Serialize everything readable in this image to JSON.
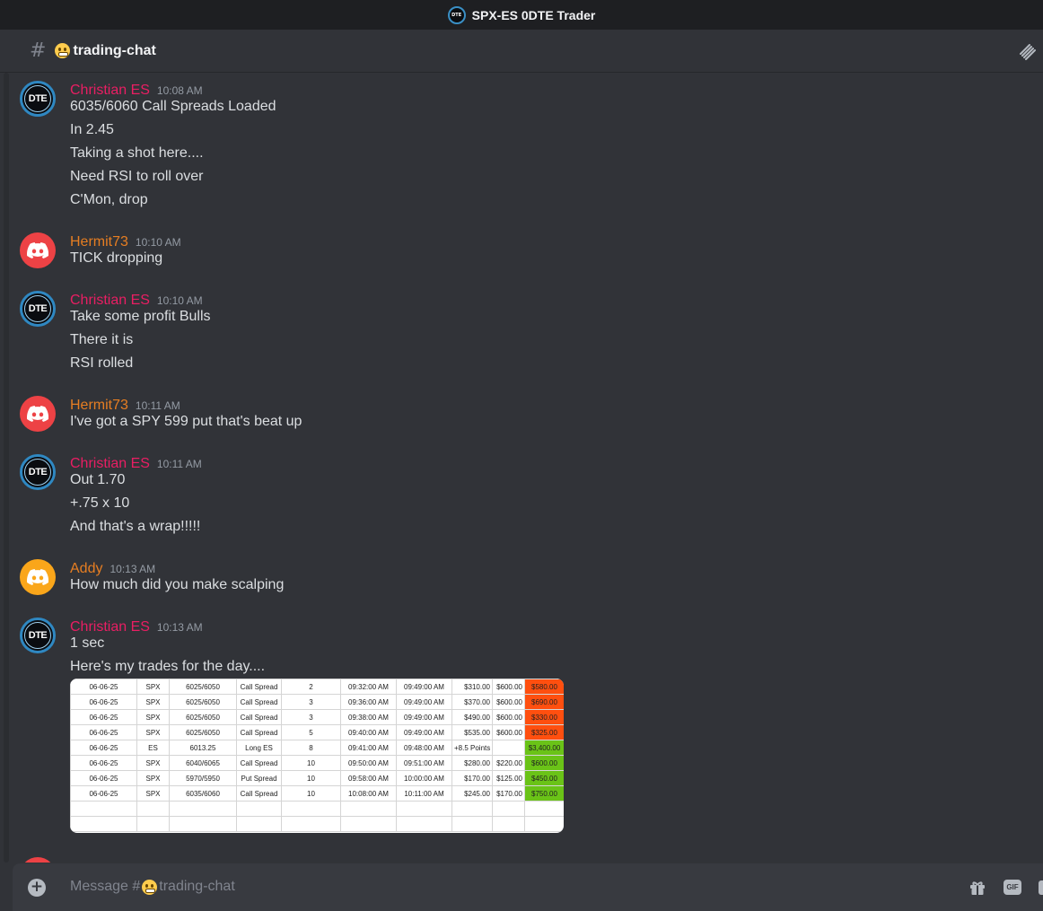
{
  "titlebar": {
    "server_name": "SPX-ES 0DTE Trader",
    "server_icon_text": "DTE"
  },
  "channel": {
    "name": "trading-chat",
    "icons": [
      "hash-icon",
      "grinning-emoji",
      "threads-icon"
    ]
  },
  "colors": {
    "christian": "#e91e63",
    "hermit": "#e67e22",
    "addy": "#e67e22",
    "background": "#313338"
  },
  "messages": [
    {
      "author": "Christian ES",
      "time": "10:08 AM",
      "lines": [
        "6035/6060 Call Spreads Loaded",
        "In 2.45",
        "Taking a shot here....",
        "Need RSI to roll over",
        "C'Mon, drop"
      ]
    },
    {
      "author": "Hermit73",
      "time": "10:10 AM",
      "lines": [
        "TICK dropping"
      ]
    },
    {
      "author": "Christian ES",
      "time": "10:10 AM",
      "lines": [
        "Take some profit Bulls",
        "There it is",
        "RSI rolled"
      ]
    },
    {
      "author": "Hermit73",
      "time": "10:11 AM",
      "lines": [
        "I've got a SPY 599 put that's beat up"
      ]
    },
    {
      "author": "Christian ES",
      "time": "10:11 AM",
      "lines": [
        "Out 1.70",
        "+.75 x 10",
        "And that's a wrap!!!!!"
      ]
    },
    {
      "author": "Addy",
      "time": "10:13 AM",
      "lines": [
        "How much did you make scalping"
      ]
    },
    {
      "author": "Christian ES",
      "time": "10:13 AM",
      "lines": [
        "1 sec",
        "Here's my trades for the day...."
      ]
    }
  ],
  "trades_sheet": {
    "rows": [
      [
        "06-06-25",
        "SPX",
        "6025/6050",
        "Call Spread",
        "2",
        "09:32:00 AM",
        "09:49:00 AM",
        "$310.00",
        "$600.00",
        "$580.00"
      ],
      [
        "06-06-25",
        "SPX",
        "6025/6050",
        "Call Spread",
        "3",
        "09:36:00 AM",
        "09:49:00 AM",
        "$370.00",
        "$600.00",
        "$690.00"
      ],
      [
        "06-06-25",
        "SPX",
        "6025/6050",
        "Call Spread",
        "3",
        "09:38:00 AM",
        "09:49:00 AM",
        "$490.00",
        "$600.00",
        "$330.00"
      ],
      [
        "06-06-25",
        "SPX",
        "6025/6050",
        "Call Spread",
        "5",
        "09:40:00 AM",
        "09:49:00 AM",
        "$535.00",
        "$600.00",
        "$325.00"
      ],
      [
        "06-06-25",
        "ES",
        "6013.25",
        "Long ES",
        "8",
        "09:41:00 AM",
        "09:48:00 AM",
        "+8.5 Points",
        "",
        "$3,400.00"
      ],
      [
        "06-06-25",
        "SPX",
        "6040/6065",
        "Call Spread",
        "10",
        "09:50:00 AM",
        "09:51:00 AM",
        "$280.00",
        "$220.00",
        "$600.00"
      ],
      [
        "06-06-25",
        "SPX",
        "5970/5950",
        "Put Spread",
        "10",
        "09:58:00 AM",
        "10:00:00 AM",
        "$170.00",
        "$125.00",
        "$450.00"
      ],
      [
        "06-06-25",
        "SPX",
        "6035/6060",
        "Call Spread",
        "10",
        "10:08:00 AM",
        "10:11:00 AM",
        "$245.00",
        "$170.00",
        "$750.00"
      ]
    ],
    "result_colors": [
      "red",
      "red",
      "red",
      "red",
      "green",
      "green",
      "green",
      "green"
    ]
  },
  "composer": {
    "placeholder_prefix": "Message #",
    "placeholder_channel": "trading-chat",
    "plus_label": "+",
    "gif_label": "GIF",
    "icons": [
      "gift-icon",
      "sticker-icon"
    ]
  }
}
